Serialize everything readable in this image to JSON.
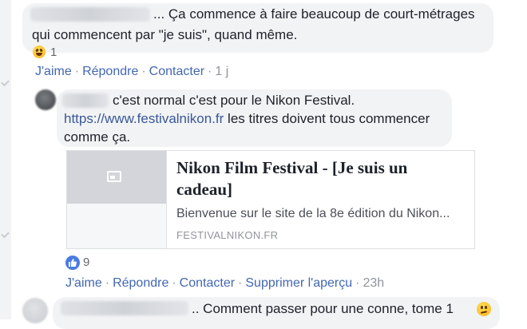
{
  "comment1": {
    "text_line1": "... Ça commence à faire beaucoup de court-métrages",
    "text_line2": "qui commencent par \"je suis\", quand même.",
    "reaction_count": "1",
    "actions": {
      "like": "J'aime",
      "reply": "Répondre",
      "contact": "Contacter",
      "time": "1 j"
    }
  },
  "reply1": {
    "text_line1": "c'est normal c'est pour le Nikon Festival.",
    "link": "https://www.festivalnikon.fr",
    "text_line2_rest": " les titres doivent tous commencer",
    "text_line3": "comme ça.",
    "preview": {
      "title": "Nikon Film Festival - [Je suis un cadeau]",
      "description": "Bienvenue sur le site de la 8e édition du Nikon...",
      "domain": "FESTIVALNIKON.FR"
    },
    "reaction_count": "9",
    "actions": {
      "like": "J'aime",
      "reply": "Répondre",
      "contact": "Contacter",
      "remove_preview": "Supprimer l'aperçu",
      "time": "23h"
    }
  },
  "comment2": {
    "text": ".. Comment passer pour une conne, tome 1"
  },
  "colors": {
    "action_blue": "#4267b2",
    "link_blue": "#385898",
    "meta_grey": "#90949c",
    "bubble_bg": "#f2f3f5"
  }
}
